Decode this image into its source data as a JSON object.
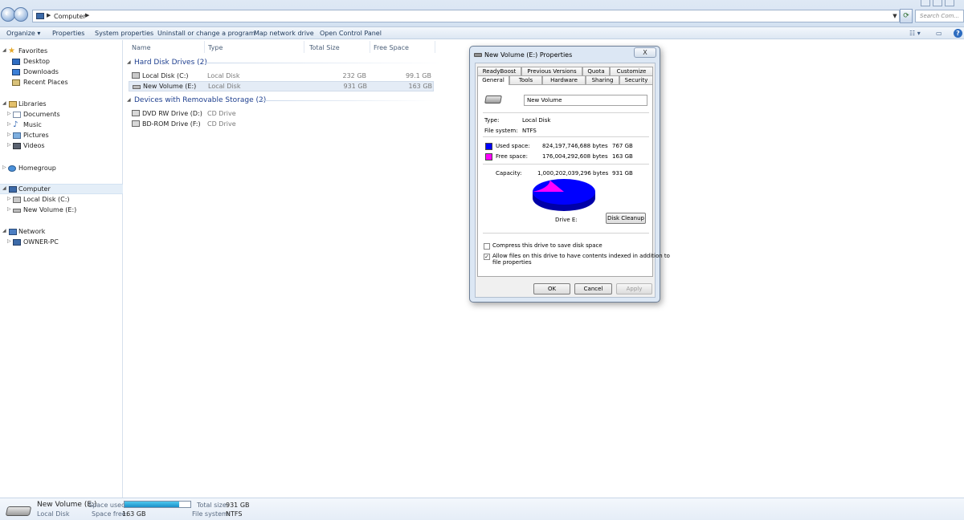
{
  "address": {
    "crumb": "Computer",
    "search_placeholder": "Search Com..."
  },
  "toolbar": {
    "organize": "Organize",
    "properties": "Properties",
    "system_properties": "System properties",
    "uninstall": "Uninstall or change a program",
    "map_drive": "Map network drive",
    "control_panel": "Open Control Panel"
  },
  "nav": {
    "favorites": "Favorites",
    "desktop": "Desktop",
    "downloads": "Downloads",
    "recent_places": "Recent Places",
    "libraries": "Libraries",
    "documents": "Documents",
    "music": "Music",
    "pictures": "Pictures",
    "videos": "Videos",
    "homegroup": "Homegroup",
    "computer": "Computer",
    "local_disk_c": "Local Disk (C:)",
    "new_volume_e": "New Volume (E:)",
    "network": "Network",
    "owner_pc": "OWNER-PC"
  },
  "columns": {
    "name": "Name",
    "type": "Type",
    "total_size": "Total Size",
    "free_space": "Free Space"
  },
  "groups": {
    "hdd": {
      "title": "Hard Disk Drives (2)",
      "items": [
        {
          "name": "Local Disk (C:)",
          "type": "Local Disk",
          "total": "232 GB",
          "free": "99.1 GB"
        },
        {
          "name": "New Volume (E:)",
          "type": "Local Disk",
          "total": "931 GB",
          "free": "163 GB"
        }
      ]
    },
    "removable": {
      "title": "Devices with Removable Storage (2)",
      "items": [
        {
          "name": "DVD RW Drive (D:)",
          "type": "CD Drive"
        },
        {
          "name": "BD-ROM Drive (F:)",
          "type": "CD Drive"
        }
      ]
    }
  },
  "details": {
    "name": "New Volume (E:)",
    "kind": "Local Disk",
    "space_used_label": "Space used:",
    "space_free_label": "Space free:",
    "space_free": "163 GB",
    "total_label": "Total size:",
    "total": "931 GB",
    "fs_label": "File system:",
    "fs": "NTFS",
    "used_fraction": 0.825
  },
  "dialog": {
    "title": "New Volume (E:) Properties",
    "close": "X",
    "tabs_back": [
      "ReadyBoost",
      "Previous Versions",
      "Quota",
      "Customize"
    ],
    "tabs_front": [
      "General",
      "Tools",
      "Hardware",
      "Sharing",
      "Security"
    ],
    "volume_name": "New Volume",
    "type_label": "Type:",
    "type_value": "Local Disk",
    "fs_label": "File system:",
    "fs_value": "NTFS",
    "used_label": "Used space:",
    "used_bytes": "824,197,746,688 bytes",
    "used_gb": "767 GB",
    "free_label": "Free space:",
    "free_bytes": "176,004,292,608 bytes",
    "free_gb": "163 GB",
    "capacity_label": "Capacity:",
    "capacity_bytes": "1,000,202,039,296 bytes",
    "capacity_gb": "931 GB",
    "drive_label": "Drive E:",
    "disk_cleanup": "Disk Cleanup",
    "compress_label": "Compress this drive to save disk space",
    "compress_checked": false,
    "index_label_1": "Allow files on this drive to have contents indexed in addition to",
    "index_label_2": "file properties",
    "index_checked": true,
    "ok": "OK",
    "cancel": "Cancel",
    "apply": "Apply",
    "used_color": "#0000ff",
    "free_color": "#ff00ff",
    "used_fraction": 0.824
  }
}
